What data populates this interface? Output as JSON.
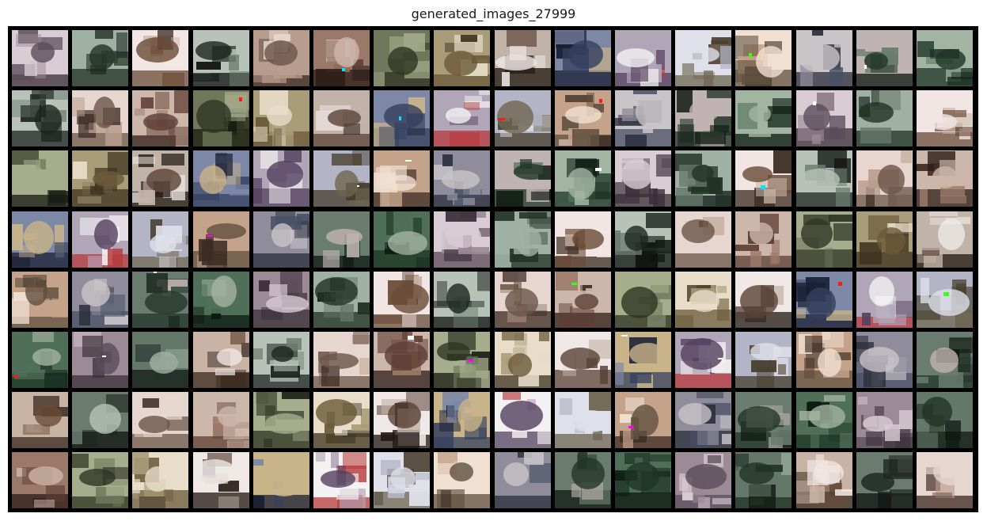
{
  "figure": {
    "title": "generated_images_27999"
  },
  "grid": {
    "rows": 8,
    "cols": 16,
    "palettes": [
      [
        "#5b4c5a",
        "#9c8a96",
        "#d9ccd4",
        "#3a2f38"
      ],
      [
        "#223326",
        "#64786a",
        "#9fb1a3",
        "#111a14"
      ],
      [
        "#6a4b37",
        "#c9b3a5",
        "#f1e6e3",
        "#3a2a20"
      ],
      [
        "#1d2521",
        "#6b7b70",
        "#b8c2b8",
        "#0f1311"
      ],
      [
        "#6c5548",
        "#b89c8d",
        "#e6d6cf",
        "#3c2a22"
      ],
      [
        "#5e3e34",
        "#9b7969",
        "#cdb7aa",
        "#2d1d18"
      ],
      [
        "#2f3423",
        "#6f785a",
        "#a6ad8c",
        "#181b12"
      ],
      [
        "#6b5a3a",
        "#a99c78",
        "#e7ddc9",
        "#3d331f"
      ],
      [
        "#5b4237",
        "#c2b3a8",
        "#efe8e6",
        "#221812"
      ],
      [
        "#35405e",
        "#7d87a6",
        "#c9b48a",
        "#1a1f33"
      ],
      [
        "#54405f",
        "#b1a5b8",
        "#f4f1f2",
        "#b73a3c"
      ],
      [
        "#6e6550",
        "#b3b5c6",
        "#dfe0ea",
        "#473d2c"
      ],
      [
        "#60503f",
        "#c5a38a",
        "#f1e0d2",
        "#3b2b22"
      ],
      [
        "#485066",
        "#8f8d9c",
        "#c9c4c8",
        "#2b2f3c"
      ],
      [
        "#233629",
        "#6a7c70",
        "#c0b3b3",
        "#0f1a12"
      ],
      [
        "#1d3526",
        "#4f6f58",
        "#a3b4a2",
        "#0c1a11"
      ]
    ]
  }
}
